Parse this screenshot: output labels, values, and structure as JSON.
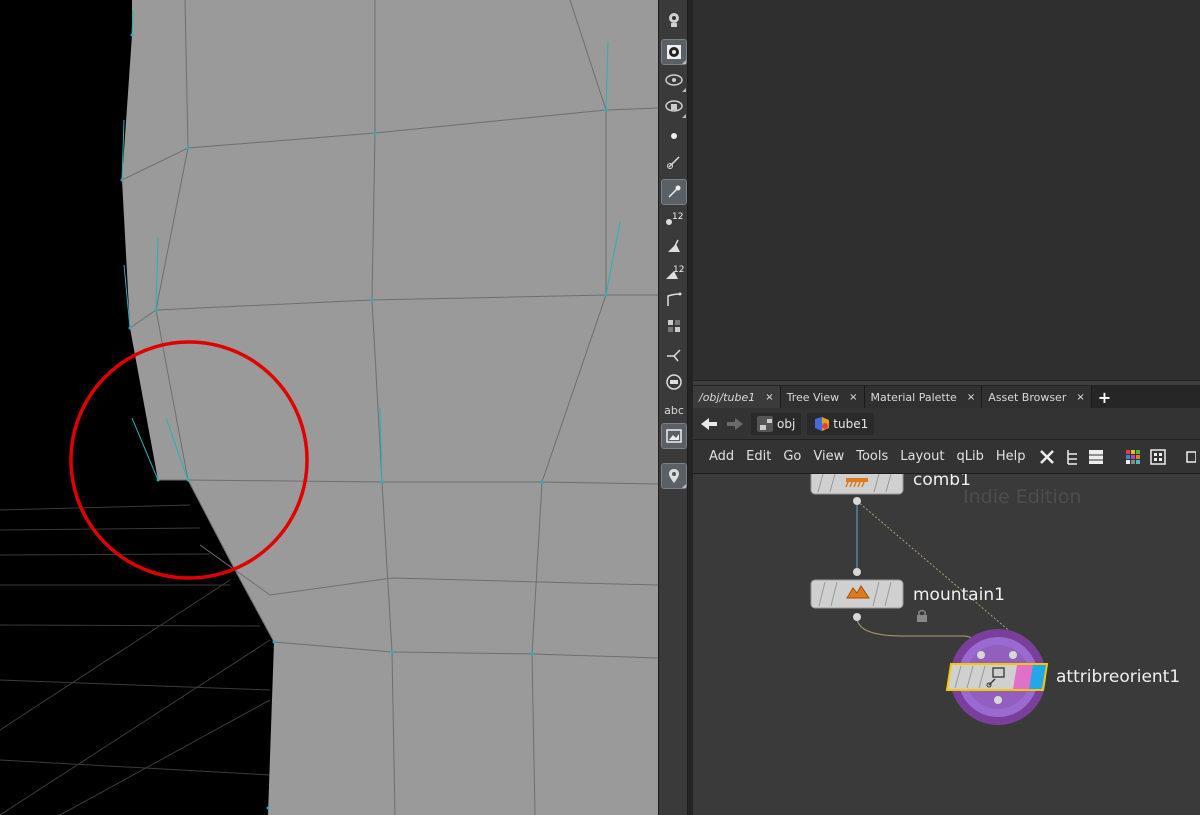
{
  "toolbar": {
    "abc_label": "abc",
    "count_badge_1": "12",
    "count_badge_2": "12"
  },
  "tabs": [
    {
      "label": "/obj/tube1",
      "close": "×"
    },
    {
      "label": "Tree View",
      "close": "×"
    },
    {
      "label": "Material Palette",
      "close": "×"
    },
    {
      "label": "Asset Browser",
      "close": "×"
    }
  ],
  "tab_add": "+",
  "path": {
    "back_icon": "arrow-left-icon",
    "forward_icon": "arrow-right-icon",
    "crumbs": [
      "obj",
      "tube1"
    ]
  },
  "menu": {
    "items": [
      "Add",
      "Edit",
      "Go",
      "View",
      "Tools",
      "Layout",
      "qLib",
      "Help"
    ]
  },
  "network": {
    "watermark": "Indie Edition",
    "nodes": [
      {
        "name": "comb1"
      },
      {
        "name": "mountain1"
      },
      {
        "name": "attribreorient1"
      }
    ]
  },
  "colors": {
    "viewport_bg": "#000000",
    "mesh_fill": "#9a9a9a",
    "highlight_circle": "#e00000",
    "normal_lines": "#2ab0b8",
    "selected_node_ring": "#8e5bb8",
    "node_flag_pink": "#e070c8",
    "node_flag_blue": "#22a8e8"
  }
}
